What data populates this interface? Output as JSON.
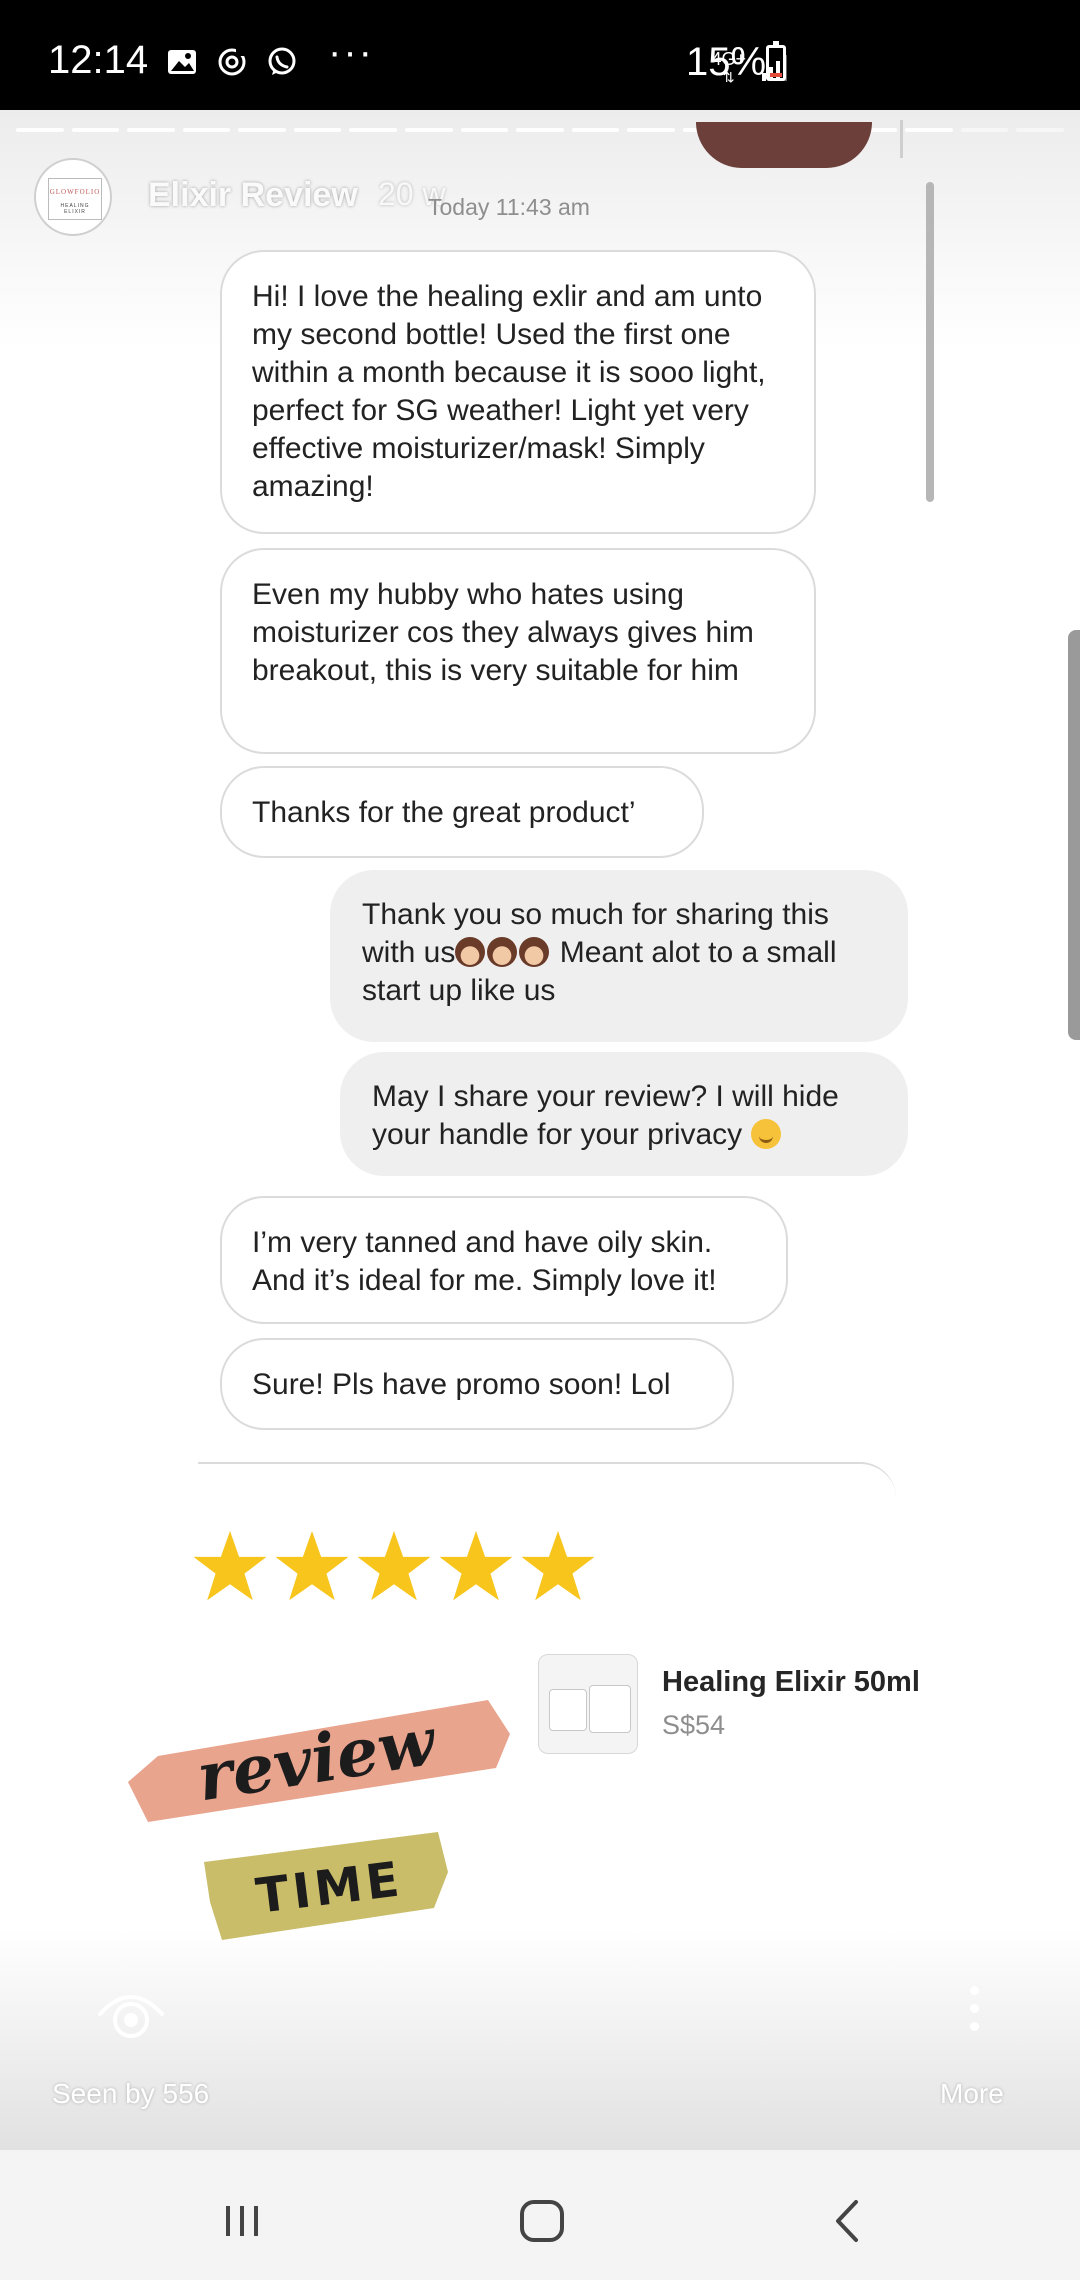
{
  "status_bar": {
    "time": "12:14",
    "dots": "···",
    "network": "4G+",
    "battery": "15%",
    "battery_level": 0.15,
    "icons": [
      "gallery-icon",
      "sync-icon",
      "whatsapp-icon",
      "signal-icon",
      "battery-icon"
    ]
  },
  "story": {
    "account_name": "Elixir Review",
    "age": "20 w",
    "avatar": {
      "logo": "GLOWFOLIO",
      "sub": "HEALING ELIXIR"
    },
    "segments_total": 19,
    "segments_viewed": 17
  },
  "chat": {
    "timestamp": "Today 11:43 am",
    "messages": [
      {
        "side": "received",
        "text": "Hi! I love the healing exlir and am unto my second bottle! Used the first one within a month because it is sooo light, perfect for SG weather! Light yet very effective moisturizer/mask! Simply amazing!"
      },
      {
        "side": "received",
        "text": "Even my hubby who hates using moisturizer cos they always gives him breakout, this is very suitable for him"
      },
      {
        "side": "received",
        "text": "Thanks for the great product’"
      },
      {
        "side": "sent",
        "text_before": "Thank you so much for sharing this with us",
        "text_after": " Meant alot to a small start up like us"
      },
      {
        "side": "sent",
        "text": "May I share your review? I will hide your handle for your privacy "
      },
      {
        "side": "received",
        "text": "I’m very tanned and have oily skin. And it’s ideal for me. Simply love it!"
      },
      {
        "side": "received",
        "text": "Sure! Pls have promo soon! Lol"
      }
    ]
  },
  "rating": {
    "stars": 5,
    "max": 5,
    "color": "#f7c51c"
  },
  "product": {
    "name": "Healing Elixir 50ml",
    "price": "S$54"
  },
  "sticker": {
    "word1": "review",
    "word2": "TIME",
    "color1": "#e9a48e",
    "color2": "#c9bd6a"
  },
  "footer": {
    "seen_by": "Seen by 556",
    "more": "More"
  },
  "nav": {
    "icons": [
      "recent-apps-icon",
      "home-icon",
      "back-icon"
    ]
  }
}
